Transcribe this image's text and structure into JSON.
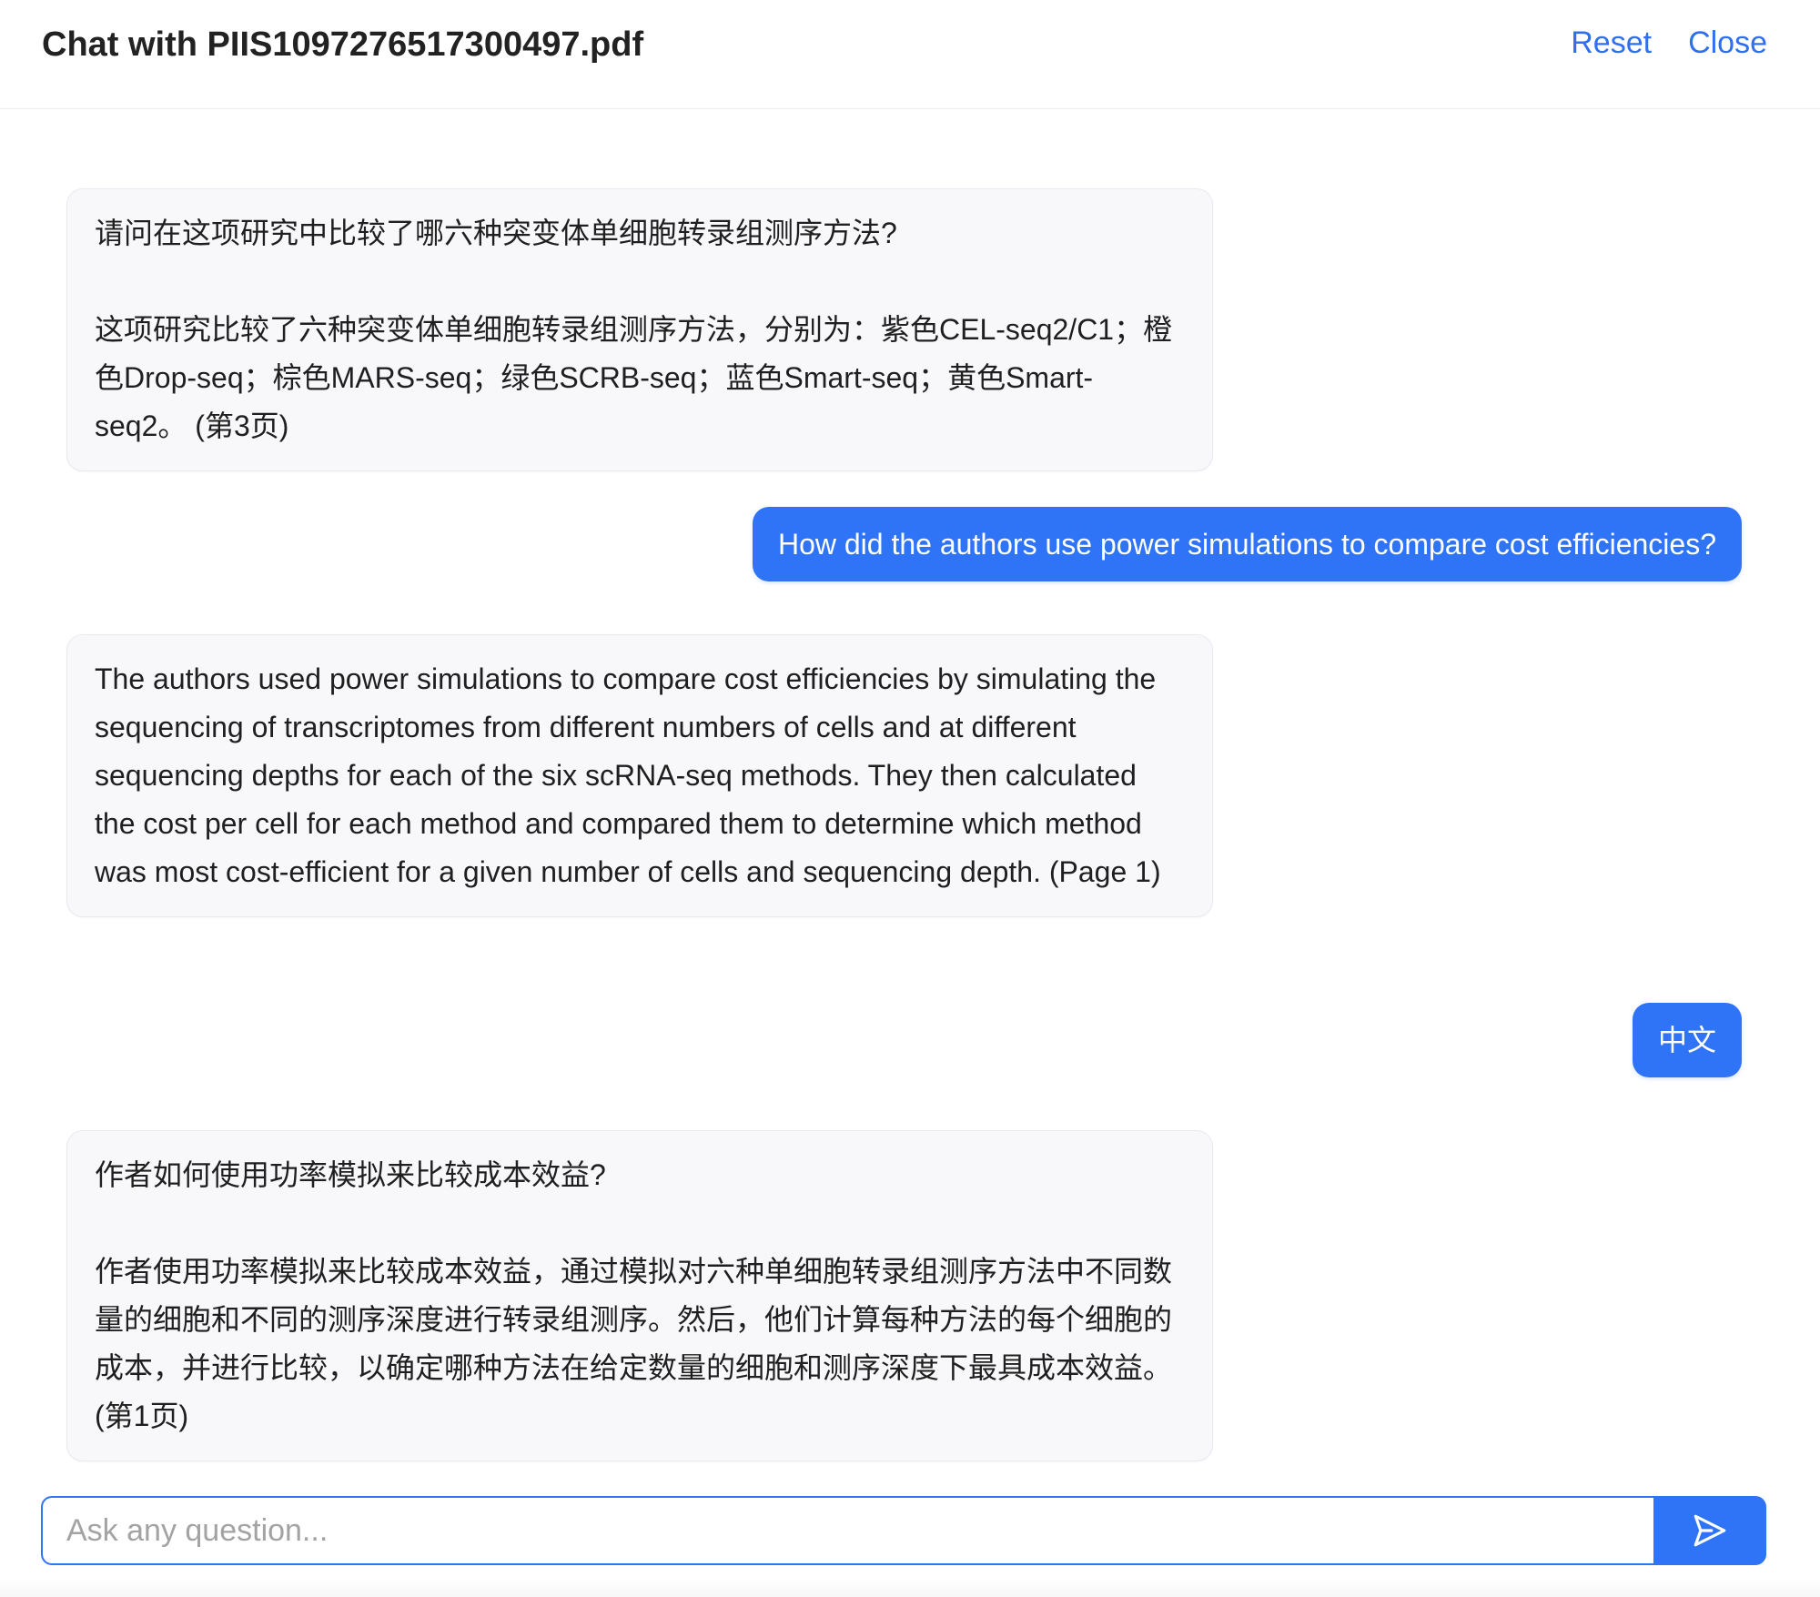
{
  "header": {
    "title": "Chat with PIIS1097276517300497.pdf",
    "reset_label": "Reset",
    "close_label": "Close"
  },
  "messages": [
    {
      "role": "assistant",
      "text": "请问在这项研究中比较了哪六种突变体单细胞转录组测序方法?\n\n这项研究比较了六种突变体单细胞转录组测序方法，分别为：紫色CEL-seq2/C1；橙色Drop-seq；棕色MARS-seq；绿色SCRB-seq；蓝色Smart-seq；黄色Smart-seq2。 (第3页)"
    },
    {
      "role": "user",
      "text": "How did the authors use power simulations to compare cost efficiencies?"
    },
    {
      "role": "assistant",
      "text": "The authors used power simulations to compare cost efficiencies by simulating the sequencing of transcriptomes from different numbers of cells and at different sequencing depths for each of the six scRNA-seq methods. They then calculated the cost per cell for each method and compared them to determine which method was most cost-efficient for a given number of cells and sequencing depth. (Page 1)"
    },
    {
      "role": "user",
      "text": "中文"
    },
    {
      "role": "assistant",
      "text": "作者如何使用功率模拟来比较成本效益?\n\n作者使用功率模拟来比较成本效益，通过模拟对六种单细胞转录组测序方法中不同数量的细胞和不同的测序深度进行转录组测序。然后，他们计算每种方法的每个细胞的成本，并进行比较，以确定哪种方法在给定数量的细胞和测序深度下最具成本效益。 (第1页)"
    }
  ],
  "composer": {
    "placeholder": "Ask any question...",
    "value": "",
    "send_icon": "send-icon"
  },
  "colors": {
    "accent": "#2f74f6",
    "link": "#2f6ff0",
    "assistant_bubble": "#f8f8fb",
    "border": "#e9e9ef"
  }
}
